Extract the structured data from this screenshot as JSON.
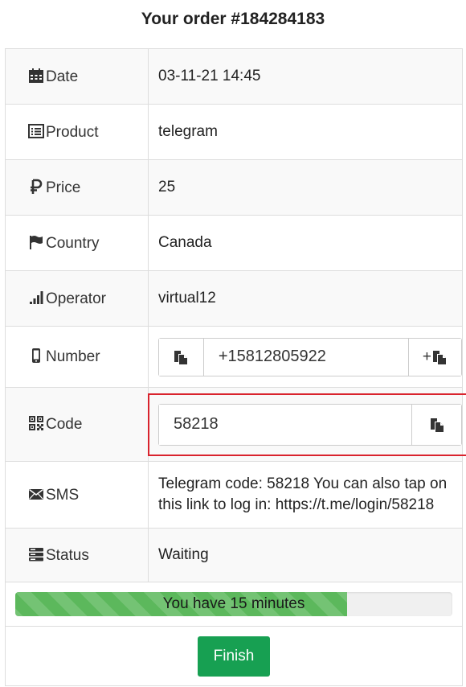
{
  "header": {
    "title": "Your order #184284183"
  },
  "rows": {
    "date": {
      "label": "Date",
      "value": "03-11-21 14:45",
      "icon": "calendar-icon"
    },
    "product": {
      "label": "Product",
      "value": "telegram",
      "icon": "list-icon"
    },
    "price": {
      "label": "Price",
      "value": "25",
      "icon": "ruble-icon"
    },
    "country": {
      "label": "Country",
      "value": "Canada",
      "icon": "flag-icon"
    },
    "operator": {
      "label": "Operator",
      "value": "virtual12",
      "icon": "signal-icon"
    },
    "number": {
      "label": "Number",
      "value": "+15812805922",
      "icon": "phone-icon",
      "copy_icon": "copy-icon",
      "plus_label": "+",
      "plus_copy_icon": "copy-icon"
    },
    "code": {
      "label": "Code",
      "value": "58218",
      "icon": "qrcode-icon",
      "copy_icon": "copy-icon"
    },
    "sms": {
      "label": "SMS",
      "value": "Telegram code: 58218 You can also tap on this link to log in: https://t.me/login/58218",
      "icon": "envelope-icon"
    },
    "status": {
      "label": "Status",
      "value": "Waiting",
      "icon": "server-icon"
    }
  },
  "progress": {
    "text": "You have 15 minutes",
    "fraction": 0.76
  },
  "finish_label": "Finish",
  "colors": {
    "highlight": "#d9232d",
    "progress": "#5cb85c",
    "finish": "#17a052"
  }
}
